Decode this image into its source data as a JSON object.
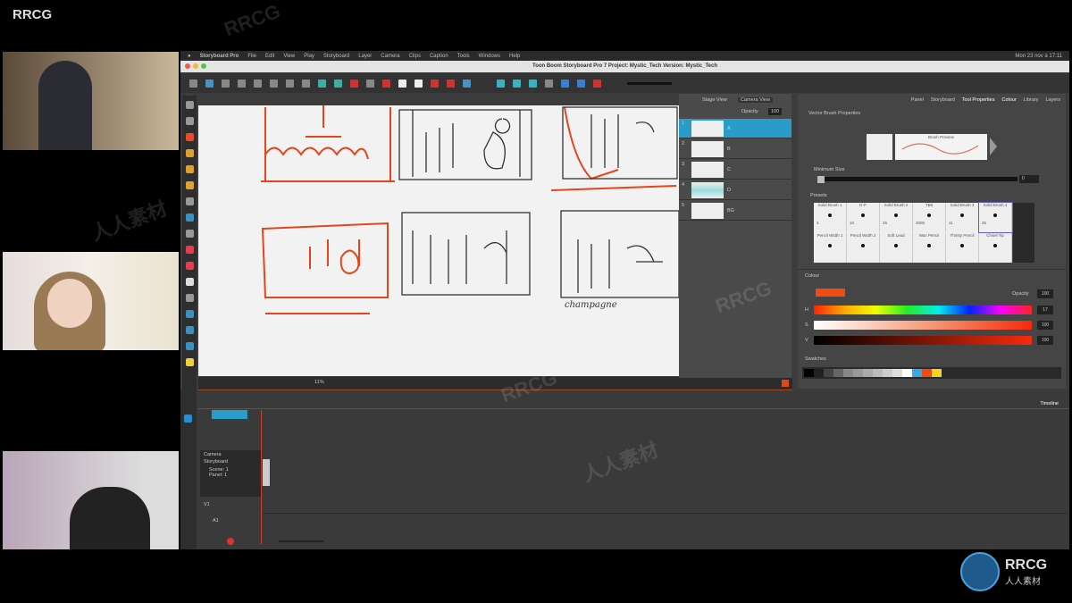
{
  "brand": "RRCG",
  "watermark": {
    "logo": "RRCG",
    "sub": "人人素材"
  },
  "menubar": {
    "items": [
      "Storyboard Pro",
      "File",
      "Edit",
      "View",
      "Play",
      "Storyboard",
      "Layer",
      "Camera",
      "Clips",
      "Caption",
      "Tools",
      "Windows",
      "Help"
    ],
    "clock": "Mon 23 nov à 17:11"
  },
  "titlebar": {
    "title": "Toon Boom Storyboard Pro 7 Project: Mystic_Tech Version: Mystic_Tech"
  },
  "views": {
    "stage": "Stage View",
    "camera": "Camera View"
  },
  "layers": {
    "opacity_label": "Opacity",
    "opacity_value": "100",
    "rows": [
      {
        "num": "1",
        "name": "A"
      },
      {
        "num": "2",
        "name": "B"
      },
      {
        "num": "3",
        "name": "C"
      },
      {
        "num": "4",
        "name": "D"
      },
      {
        "num": "5",
        "name": "BG"
      }
    ]
  },
  "right_tabs": [
    "Panel",
    "Storyboard",
    "Tool Properties",
    "Colour",
    "Library",
    "Layers"
  ],
  "tool_props": {
    "section": "Vector Brush Properties",
    "brush_preview": "Brush Preview",
    "min_size_label": "Minimum Size",
    "min_size": "0",
    "presets_label": "Presets",
    "presets": [
      {
        "name": "Solid Brush 1",
        "size": "3"
      },
      {
        "name": "D-P",
        "size": "10"
      },
      {
        "name": "Solid Brush 2",
        "size": "25"
      },
      {
        "name": "TB6",
        "size": "3000"
      },
      {
        "name": "Solid Brush 3",
        "size": "11"
      },
      {
        "name": "Solid Brush 4",
        "size": "25"
      },
      {
        "name": "Pencil Width 1",
        "size": ""
      },
      {
        "name": "Pencil Width 2",
        "size": ""
      },
      {
        "name": "Soft Lead",
        "size": ""
      },
      {
        "name": "Wax Pencil",
        "size": ""
      },
      {
        "name": "Thirsty Pencil",
        "size": ""
      },
      {
        "name": "Chisel Tip",
        "size": ""
      }
    ],
    "selected_preset": "Solid Brush 4"
  },
  "colour": {
    "section": "Colour",
    "opacity_label": "Opacity",
    "opacity": "100",
    "current": "#f04b12",
    "h_label": "H",
    "s_label": "S",
    "v_label": "V",
    "h": "17",
    "s": "100",
    "v": "100",
    "swatches_label": "Swatches",
    "swatches": [
      "#000000",
      "#222222",
      "#444444",
      "#666666",
      "#888888",
      "#999999",
      "#aaaaaa",
      "#bbbbbb",
      "#cccccc",
      "#dddddd",
      "#ffffff",
      "#3aa7e8",
      "#f04b12",
      "#f5d321"
    ]
  },
  "canvas": {
    "zoom": "11%",
    "caption": "champagne"
  },
  "timeline": {
    "title": "Timeline",
    "tracks": [
      "Camera",
      "Storyboard",
      "Scene: 1",
      "Panel: 1",
      "V1",
      "A1"
    ]
  }
}
